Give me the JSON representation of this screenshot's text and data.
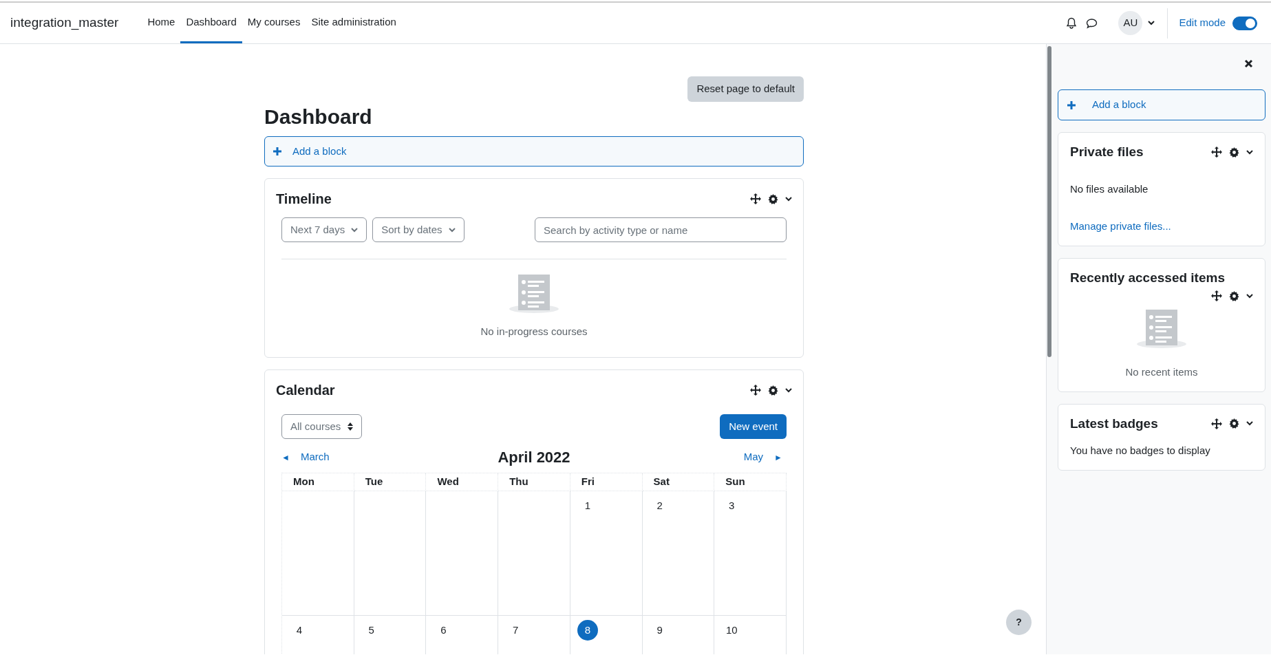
{
  "site_name": "integration_master",
  "nav": [
    {
      "label": "Home",
      "selected": false
    },
    {
      "label": "Dashboard",
      "selected": true
    },
    {
      "label": "My courses",
      "selected": false
    },
    {
      "label": "Site administration",
      "selected": false
    }
  ],
  "user_initials": "AU",
  "edit_mode": {
    "label": "Edit mode",
    "on": true
  },
  "reset_button": "Reset page to default",
  "page_title": "Dashboard",
  "add_block": "Add a block",
  "timeline": {
    "title": "Timeline",
    "filters": [
      "Next 7 days",
      "Sort by dates"
    ],
    "search": {
      "placeholder": "Search by activity type or name"
    },
    "empty_message": "No in-progress courses"
  },
  "calendar": {
    "title": "Calendar",
    "course_filter": "All courses",
    "new_event": "New event",
    "prev_arrow": "◄",
    "prev_month": "March",
    "month": "April 2022",
    "next_month": "May",
    "next_arrow": "►",
    "weekdays": [
      "Mon",
      "Tue",
      "Wed",
      "Thu",
      "Fri",
      "Sat",
      "Sun"
    ],
    "weeks": [
      [
        {
          "kind": "blank"
        },
        {
          "kind": "blank"
        },
        {
          "kind": "blank"
        },
        {
          "kind": "blank"
        },
        {
          "kind": "day",
          "day": "1",
          "today": false
        },
        {
          "kind": "day",
          "day": "2",
          "today": false
        },
        {
          "kind": "day",
          "day": "3",
          "today": false
        }
      ],
      [
        {
          "kind": "day",
          "day": "4",
          "today": false
        },
        {
          "kind": "day",
          "day": "5",
          "today": false
        },
        {
          "kind": "day",
          "day": "6",
          "today": false
        },
        {
          "kind": "day",
          "day": "7",
          "today": false
        },
        {
          "kind": "day",
          "day": "8",
          "today": true
        },
        {
          "kind": "day",
          "day": "9",
          "today": false
        },
        {
          "kind": "day",
          "day": "10",
          "today": false
        }
      ]
    ]
  },
  "drawer": {
    "add_block": "Add a block",
    "blocks": [
      {
        "kind": "files",
        "title": "Private files",
        "message": "No files available",
        "link": "Manage private files..."
      },
      {
        "kind": "recent",
        "title": "Recently accessed items",
        "message": "No recent items"
      },
      {
        "kind": "badges",
        "title": "Latest badges",
        "message": "You have no badges to display"
      }
    ]
  },
  "help_button": "?"
}
